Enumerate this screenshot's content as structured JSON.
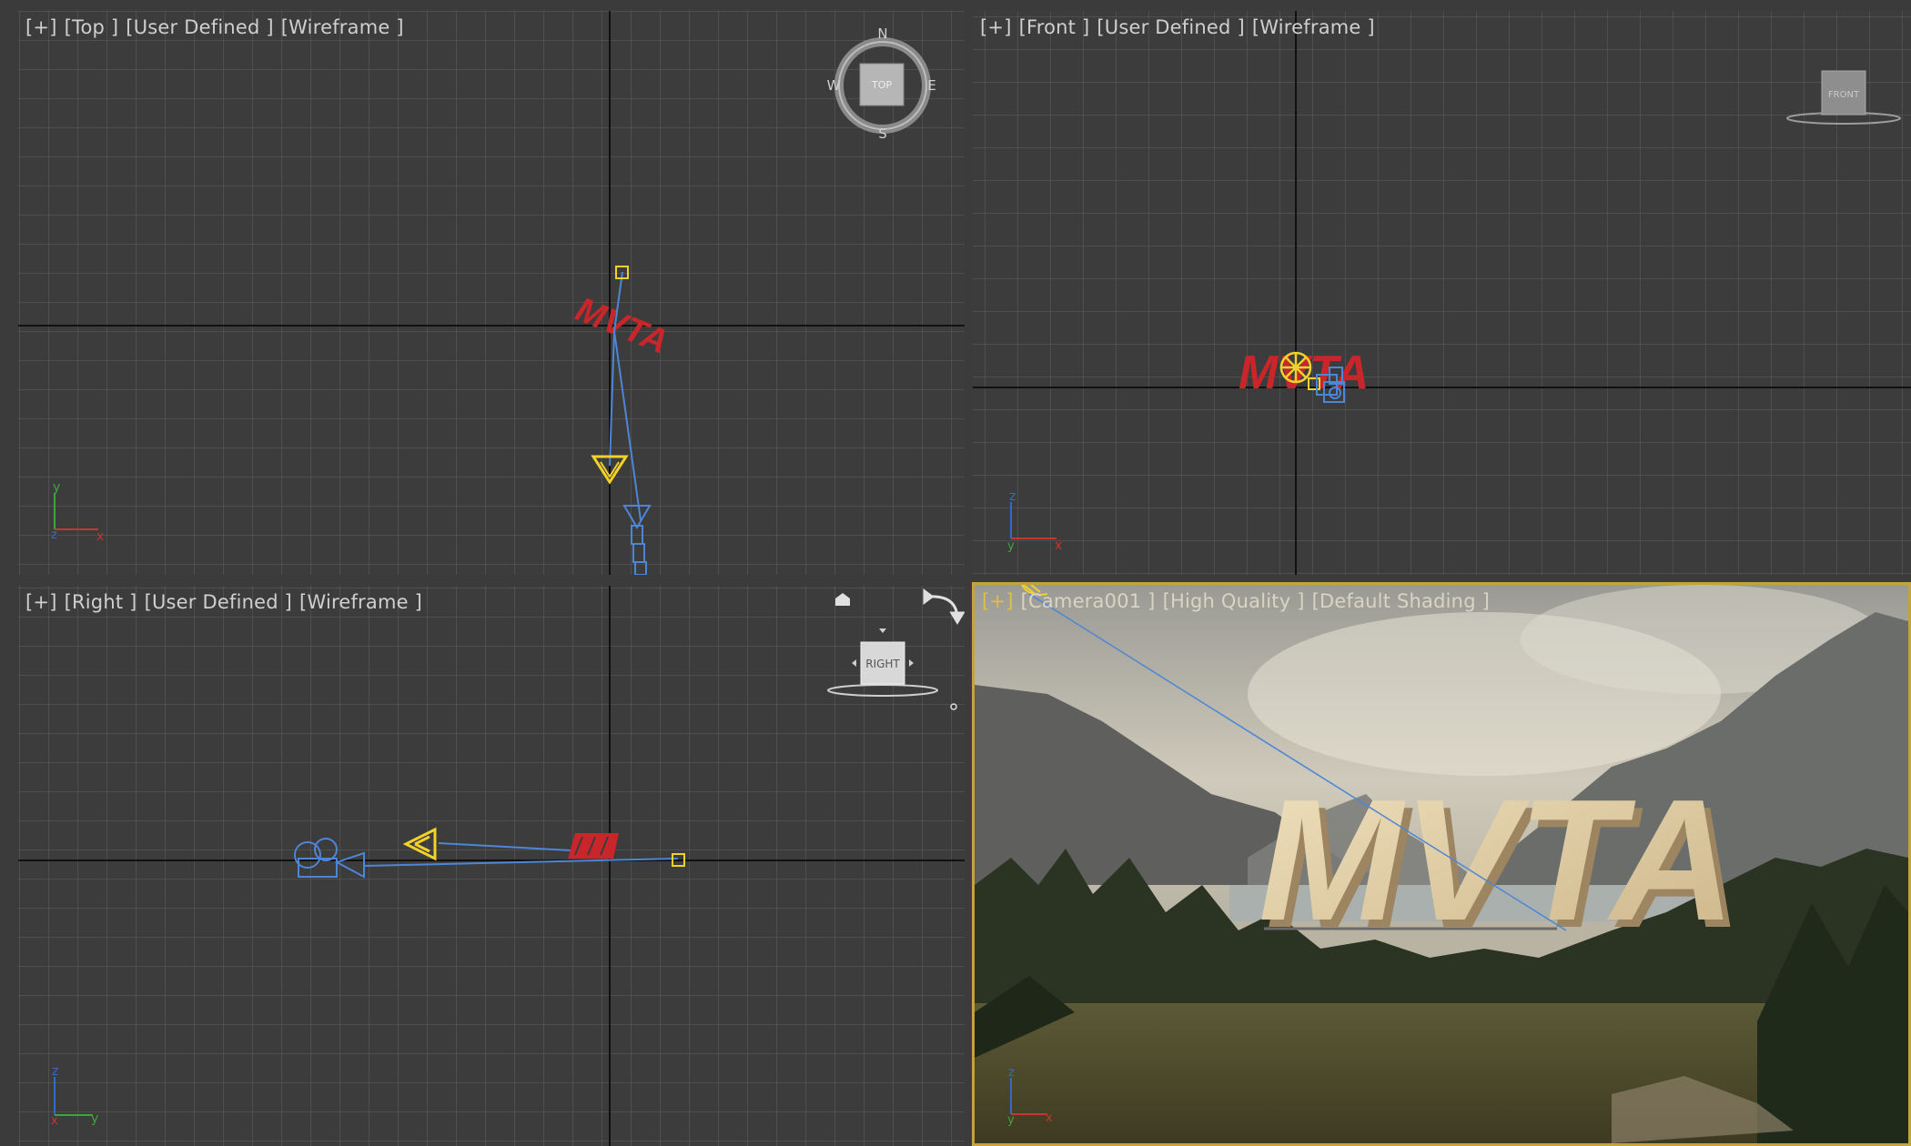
{
  "viewports": {
    "top": {
      "label": {
        "plus": "[+]",
        "view": "[Top ]",
        "mode": "[User Defined ]",
        "shading": "[Wireframe ]"
      },
      "viewcube": {
        "face": "TOP",
        "n": "N",
        "s": "S",
        "e": "E",
        "w": "W"
      },
      "axis": {
        "a": "y",
        "b": "x",
        "c": "z"
      },
      "text_object": "MVTA"
    },
    "front": {
      "label": {
        "plus": "[+]",
        "view": "[Front ]",
        "mode": "[User Defined ]",
        "shading": "[Wireframe ]"
      },
      "viewcube": {
        "face": "FRONT"
      },
      "axis": {
        "a": "z",
        "b": "x",
        "c": "y"
      },
      "text_object": "MVTA"
    },
    "right": {
      "label": {
        "plus": "[+]",
        "view": "[Right ]",
        "mode": "[User Defined ]",
        "shading": "[Wireframe ]"
      },
      "viewcube": {
        "face": "RIGHT"
      },
      "axis": {
        "a": "z",
        "b": "y",
        "c": "x"
      },
      "text_object": "MVTA"
    },
    "camera": {
      "label": {
        "plus": "[+]",
        "view": "[Camera001 ]",
        "mode": "[High Quality ]",
        "shading": "[Default Shading ]"
      },
      "scene_text": "MVTA",
      "axis": {
        "a": "z",
        "b": "x",
        "c": "y"
      }
    }
  },
  "colors": {
    "viewport_bg": "#3c3c3c",
    "grid": "#5a5a5a",
    "grid_axis": "#111111",
    "text_object": "#c8262a",
    "camera_wire": "#4d86d6",
    "light": "#f1d12a",
    "active_border": "#c4a33c"
  }
}
